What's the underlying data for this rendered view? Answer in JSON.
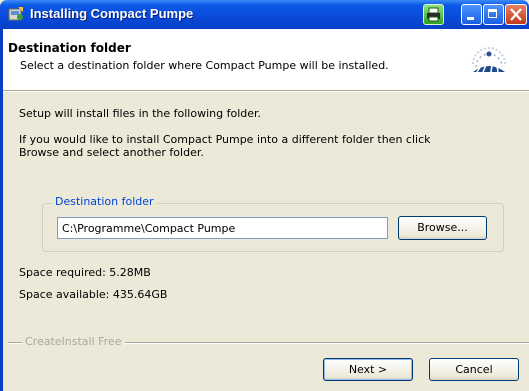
{
  "window": {
    "title": "Installing Compact Pumpe",
    "titlebar_buttons": [
      "print-icon",
      "minimize-icon",
      "maximize-icon",
      "close-icon"
    ],
    "accent_color": "#0a49d8"
  },
  "header": {
    "title": "Destination folder",
    "subtitle": "Select a destination folder where Compact Pumpe will be installed.",
    "logo_icon": "installer-logo-icon"
  },
  "body": {
    "intro": "Setup will install files in the following folder.",
    "info_line1": "If you would like to install Compact Pumpe into a different folder then click",
    "info_line2": "Browse and select another folder."
  },
  "destination": {
    "group_label": "Destination folder",
    "path": "C:\\Programme\\Compact Pumpe",
    "browse_label": "Browse..."
  },
  "space": {
    "required": "Space required: 5.28MB",
    "available": "Space available: 435.64GB"
  },
  "footer": {
    "brand": "CreateInstall Free",
    "next_label": "Next >",
    "cancel_label": "Cancel"
  }
}
